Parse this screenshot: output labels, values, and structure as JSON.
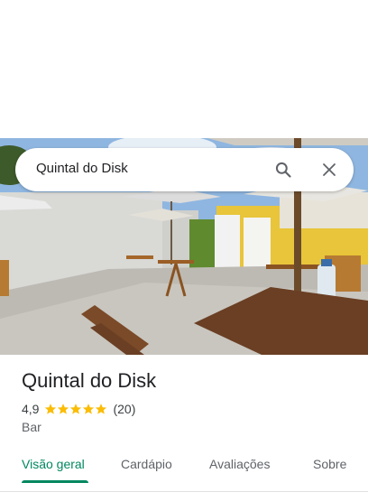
{
  "search": {
    "query": "Quintal do Disk",
    "search_icon": "search-icon",
    "clear_icon": "close-icon"
  },
  "place": {
    "title": "Quintal do Disk",
    "rating": "4,9",
    "stars": 5,
    "review_count": "(20)",
    "category": "Bar"
  },
  "tabs": [
    {
      "label": "Visão geral",
      "active": true
    },
    {
      "label": "Cardápio",
      "active": false
    },
    {
      "label": "Avaliações",
      "active": false
    },
    {
      "label": "Sobre",
      "active": false
    }
  ],
  "colors": {
    "accent": "#01875f",
    "star": "#fbbc04",
    "text_primary": "#202124",
    "text_secondary": "#5f6368"
  }
}
